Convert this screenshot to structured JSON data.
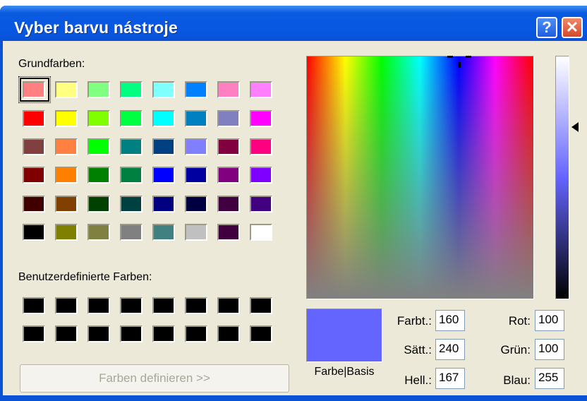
{
  "window": {
    "title": "Vyber barvu nástroje",
    "help_symbol": "?",
    "close_symbol": "✕"
  },
  "basic_colors": {
    "label": "Grundfarben:",
    "selected_index": 0,
    "swatches": [
      "#ff8080",
      "#ffff80",
      "#80ff80",
      "#00ff80",
      "#80ffff",
      "#0080ff",
      "#ff80c0",
      "#ff80ff",
      "#ff0000",
      "#ffff00",
      "#80ff00",
      "#00ff40",
      "#00ffff",
      "#0080c0",
      "#8080c0",
      "#ff00ff",
      "#804040",
      "#ff8040",
      "#00ff00",
      "#008080",
      "#004080",
      "#8080ff",
      "#800040",
      "#ff0080",
      "#800000",
      "#ff8000",
      "#008000",
      "#008040",
      "#0000ff",
      "#0000a0",
      "#800080",
      "#8000ff",
      "#400000",
      "#804000",
      "#004000",
      "#004040",
      "#000080",
      "#000040",
      "#400040",
      "#400080",
      "#000000",
      "#808000",
      "#808040",
      "#808080",
      "#408080",
      "#c0c0c0",
      "#400040",
      "#ffffff"
    ]
  },
  "custom_colors": {
    "label": "Benutzerdefinierte Farben:",
    "swatches": [
      "#000000",
      "#000000",
      "#000000",
      "#000000",
      "#000000",
      "#000000",
      "#000000",
      "#000000",
      "#000000",
      "#000000",
      "#000000",
      "#000000",
      "#000000",
      "#000000",
      "#000000",
      "#000000"
    ]
  },
  "define_button": {
    "label": "Farben definieren >>"
  },
  "preview": {
    "label": "Farbe|Basis",
    "color": "#6464ff"
  },
  "fields": {
    "hue": {
      "label": "Farbt.:",
      "value": "160"
    },
    "saturation": {
      "label": "Sätt.:",
      "value": "240"
    },
    "luminance": {
      "label": "Hell.:",
      "value": "167"
    },
    "red": {
      "label": "Rot:",
      "value": "100"
    },
    "green": {
      "label": "Grün:",
      "value": "100"
    },
    "blue": {
      "label": "Blau:",
      "value": "255"
    }
  }
}
